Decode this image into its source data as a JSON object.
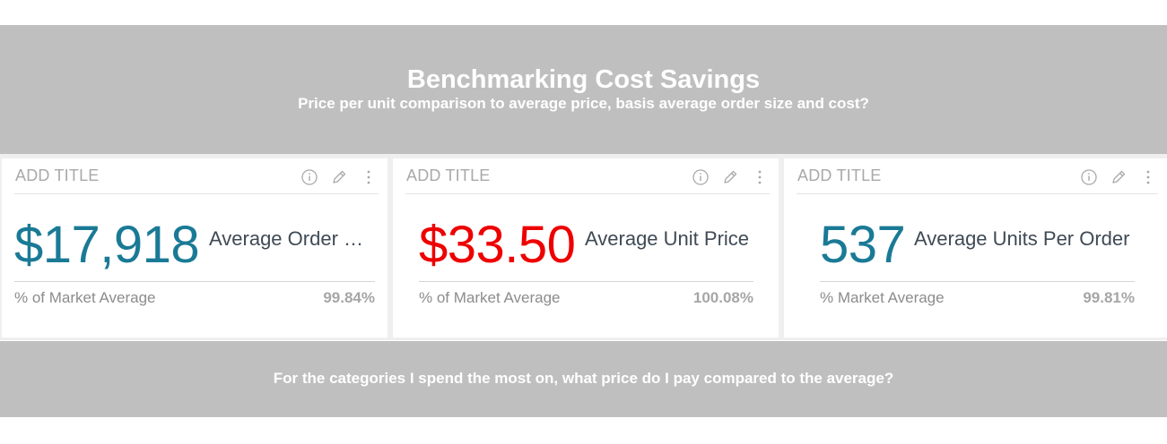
{
  "header": {
    "title": "Benchmarking Cost Savings",
    "subtitle": "Price per unit comparison to average price, basis average order size and cost?"
  },
  "cards": [
    {
      "title": "ADD TITLE",
      "value": "$17,918",
      "value_color": "#1a7a96",
      "label": "Average Order …",
      "footer_label": "% of Market Average",
      "footer_value": "99.84%"
    },
    {
      "title": "ADD TITLE",
      "value": "$33.50",
      "value_color": "#ee0000",
      "label": "Average Unit Price",
      "footer_label": "% of Market Average",
      "footer_value": "100.08%"
    },
    {
      "title": "ADD TITLE",
      "value": "537",
      "value_color": "#1a7a96",
      "label": "Average Units Per Order",
      "footer_label": "% Market Average",
      "footer_value": "99.81%"
    }
  ],
  "card_icons": [
    "info-icon",
    "pencil-icon",
    "more-vertical-icon"
  ],
  "footer_banner": {
    "text": "For the categories I spend the most on, what price do I pay compared to the average?"
  }
}
